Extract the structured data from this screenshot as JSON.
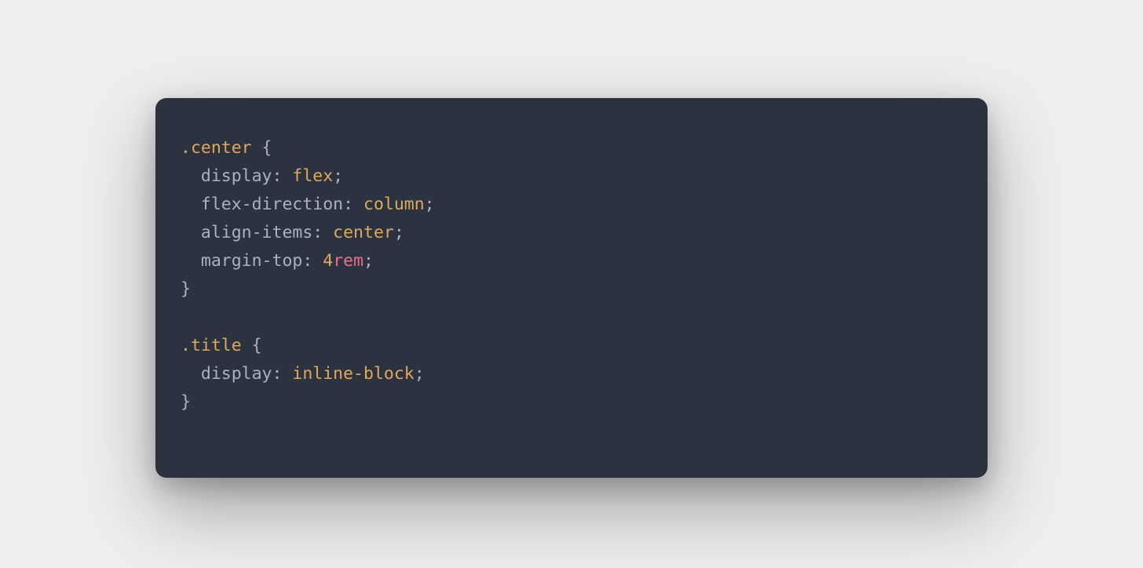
{
  "code": {
    "rule1": {
      "selector": ".center",
      "decls": [
        {
          "prop": "display",
          "value": "flex"
        },
        {
          "prop": "flex-direction",
          "value": "column"
        },
        {
          "prop": "align-items",
          "value": "center"
        },
        {
          "prop": "margin-top",
          "number": "4",
          "unit": "rem"
        }
      ]
    },
    "rule2": {
      "selector": ".title",
      "decls": [
        {
          "prop": "display",
          "value": "inline-block"
        }
      ]
    }
  },
  "punct": {
    "openBrace": " {",
    "closeBrace": "}",
    "colonSpace": ": ",
    "semicolon": ";",
    "indent": "  "
  }
}
